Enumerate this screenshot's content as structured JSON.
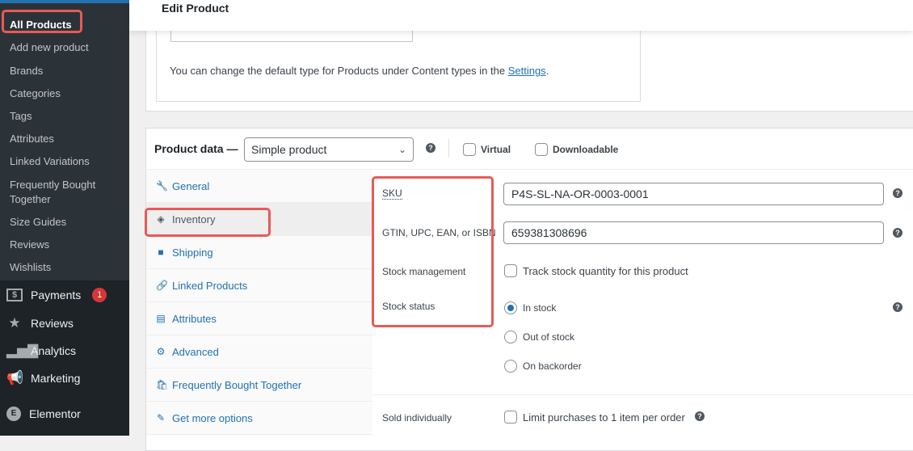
{
  "sidebar": {
    "submenu": [
      "All Products",
      "Add new product",
      "Brands",
      "Categories",
      "Tags",
      "Attributes",
      "Linked Variations",
      "Frequently Bought Together",
      "Size Guides",
      "Reviews",
      "Wishlists"
    ],
    "menu": [
      {
        "label": "Payments",
        "icon": "dollar-icon",
        "badge": "1"
      },
      {
        "label": "Reviews",
        "icon": "star-icon"
      },
      {
        "label": "Analytics",
        "icon": "bar-chart-icon"
      },
      {
        "label": "Marketing",
        "icon": "megaphone-icon"
      },
      {
        "label": "Elementor",
        "icon": "elementor-icon"
      }
    ]
  },
  "header": {
    "title": "Edit Product"
  },
  "content_type_note": {
    "text": "You can change the default type for Products under Content types in the ",
    "link": "Settings",
    "suffix": "."
  },
  "product_data": {
    "label": "Product data —",
    "type_select": "Simple product",
    "virtual": "Virtual",
    "virtual_checked": false,
    "downloadable": "Downloadable",
    "downloadable_checked": false,
    "tabs": [
      {
        "label": "General",
        "icon": "wrench-icon"
      },
      {
        "label": "Inventory",
        "icon": "tag-icon",
        "active": true
      },
      {
        "label": "Shipping",
        "icon": "truck-icon"
      },
      {
        "label": "Linked Products",
        "icon": "link-icon"
      },
      {
        "label": "Attributes",
        "icon": "list-icon"
      },
      {
        "label": "Advanced",
        "icon": "gear-icon"
      },
      {
        "label": "Frequently Bought Together",
        "icon": "bag-icon"
      },
      {
        "label": "Get more options",
        "icon": "plugin-icon"
      }
    ],
    "inventory": {
      "sku_label": "SKU",
      "sku": "P4S-SL-NA-OR-0003-0001",
      "gtin_label": "GTIN, UPC, EAN, or ISBN",
      "gtin": "659381308696",
      "stock_mgmt_label": "Stock management",
      "track_stock": "Track stock quantity for this product",
      "track_checked": false,
      "stock_status_label": "Stock status",
      "stock_options": [
        "In stock",
        "Out of stock",
        "On backorder"
      ],
      "stock_selected": "In stock",
      "sold_individually_label": "Sold individually",
      "limit_text": "Limit purchases to 1 item per order",
      "limit_checked": false
    }
  },
  "colors": {
    "accent": "#2271b1",
    "highlight": "#e85a55",
    "sidebar": "#1d2327",
    "badge": "#d63638"
  }
}
